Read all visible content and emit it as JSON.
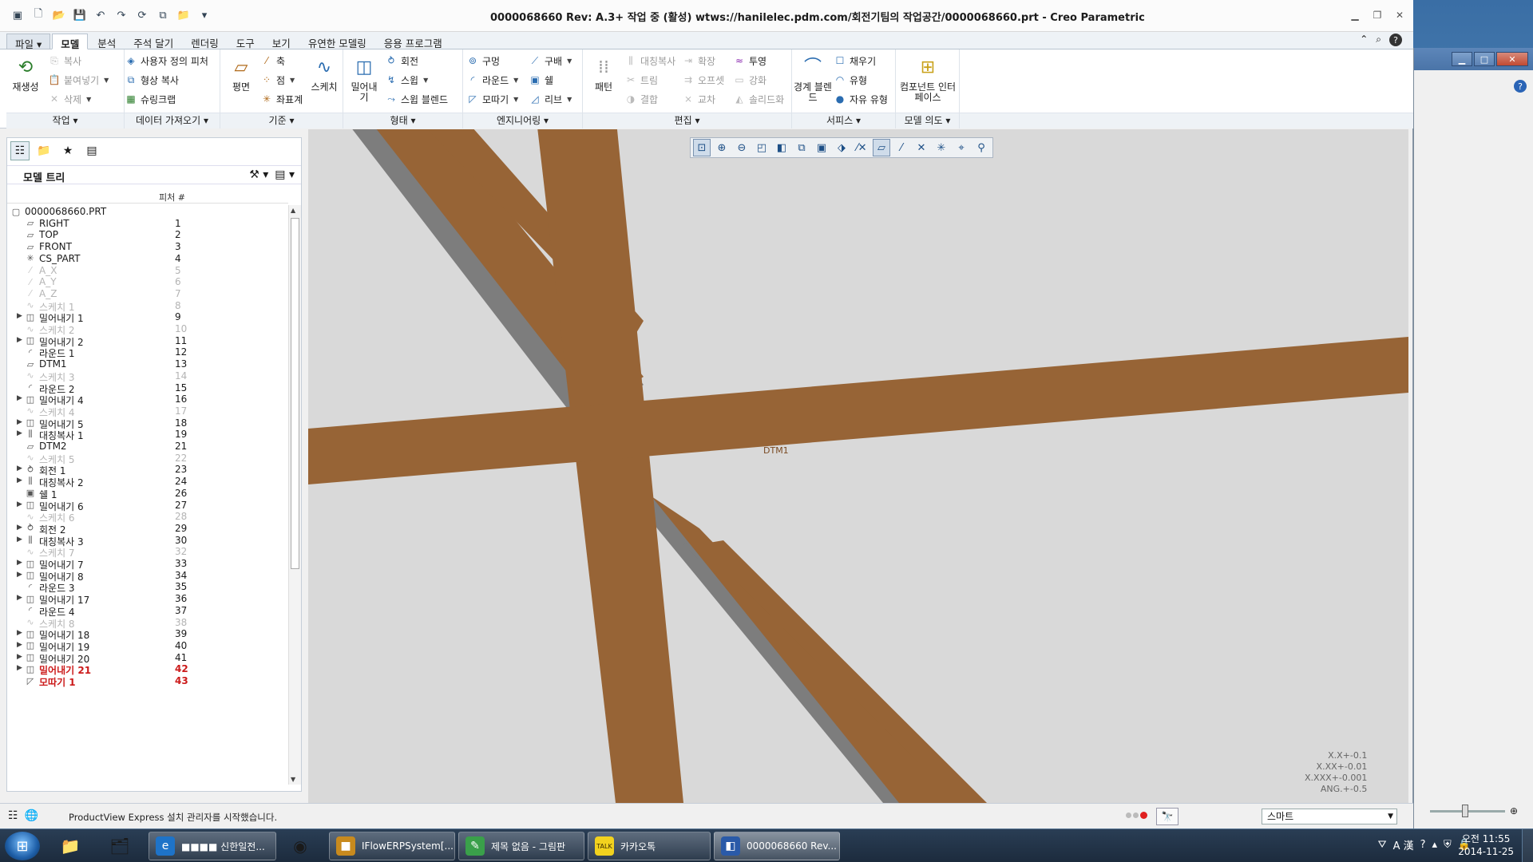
{
  "window": {
    "title": "0000068660 Rev: A.3+ 작업 중  (활성) wtws://hanilelec.pdm.com/회전기팀의 작업공간/0000068660.prt - Creo Parametric"
  },
  "tabs": [
    {
      "label": "파일 ▾",
      "kind": "file"
    },
    {
      "label": "모델",
      "kind": "active"
    },
    {
      "label": "분석",
      "kind": ""
    },
    {
      "label": "주석 달기",
      "kind": ""
    },
    {
      "label": "렌더링",
      "kind": ""
    },
    {
      "label": "도구",
      "kind": ""
    },
    {
      "label": "보기",
      "kind": ""
    },
    {
      "label": "유연한 모델링",
      "kind": ""
    },
    {
      "label": "응용 프로그램",
      "kind": ""
    }
  ],
  "ribbon": {
    "groups": {
      "operations": "작업",
      "get_data": "데이터 가져오기",
      "datum": "기준",
      "shapes": "형태",
      "engineering": "엔지니어링",
      "editing": "편집",
      "surfaces": "서피스",
      "model_intent": "모델 의도"
    },
    "regenerate": "재생성",
    "copy": "복사",
    "paste": "붙여넣기",
    "delete": "삭제",
    "user_defined_feature": "사용자 정의 피처",
    "copy_geometry": "형상 복사",
    "shrinkwrap": "슈링크랩",
    "plane": "평면",
    "axis": "축",
    "point": "점",
    "csys": "좌표계",
    "sketch": "스케치",
    "extrude": "밀어내기",
    "revolve": "회전",
    "sweep": "스윕",
    "swept_blend": "스윕 블렌드",
    "hole": "구멍",
    "round": "라운드",
    "chamfer": "모따기",
    "draft": "구배",
    "shell": "쉘",
    "rib": "리브",
    "pattern": "패턴",
    "mirror": "대칭복사",
    "trim": "트림",
    "merge": "결합",
    "extend": "확장",
    "offset": "오프셋",
    "intersect": "교차",
    "project": "투영",
    "thicken": "강화",
    "solidify": "솔리드화",
    "boundary_blend": "경계 블렌드",
    "fill": "채우기",
    "style": "유형",
    "freestyle": "자유 유형",
    "component_interface": "컴포넌트 인터페이스"
  },
  "model_tree": {
    "title": "모델 트리",
    "column_feature": "피처 #",
    "items": [
      {
        "name": "0000068660.PRT",
        "num": "",
        "icon": "part",
        "state": "",
        "expand": "",
        "root": true
      },
      {
        "name": "RIGHT",
        "num": "1",
        "icon": "plane",
        "state": "",
        "expand": ""
      },
      {
        "name": "TOP",
        "num": "2",
        "icon": "plane",
        "state": "",
        "expand": ""
      },
      {
        "name": "FRONT",
        "num": "3",
        "icon": "plane",
        "state": "",
        "expand": ""
      },
      {
        "name": "CS_PART",
        "num": "4",
        "icon": "csys",
        "state": "",
        "expand": ""
      },
      {
        "name": "A_X",
        "num": "5",
        "icon": "axis",
        "state": "dim",
        "expand": ""
      },
      {
        "name": "A_Y",
        "num": "6",
        "icon": "axis",
        "state": "dim",
        "expand": ""
      },
      {
        "name": "A_Z",
        "num": "7",
        "icon": "axis",
        "state": "dim",
        "expand": ""
      },
      {
        "name": "스케치 1",
        "num": "8",
        "icon": "sketch",
        "state": "dim",
        "expand": ""
      },
      {
        "name": "밀어내기 1",
        "num": "9",
        "icon": "extrude",
        "state": "",
        "expand": "▶"
      },
      {
        "name": "스케치 2",
        "num": "10",
        "icon": "sketch",
        "state": "dim",
        "expand": ""
      },
      {
        "name": "밀어내기 2",
        "num": "11",
        "icon": "extrude",
        "state": "",
        "expand": "▶"
      },
      {
        "name": "라운드 1",
        "num": "12",
        "icon": "round",
        "state": "",
        "expand": ""
      },
      {
        "name": "DTM1",
        "num": "13",
        "icon": "plane",
        "state": "",
        "expand": ""
      },
      {
        "name": "스케치 3",
        "num": "14",
        "icon": "sketch",
        "state": "dim",
        "expand": ""
      },
      {
        "name": "라운드 2",
        "num": "15",
        "icon": "round",
        "state": "",
        "expand": ""
      },
      {
        "name": "밀어내기 4",
        "num": "16",
        "icon": "extrude",
        "state": "",
        "expand": "▶"
      },
      {
        "name": "스케치 4",
        "num": "17",
        "icon": "sketch",
        "state": "dim",
        "expand": ""
      },
      {
        "name": "밀어내기 5",
        "num": "18",
        "icon": "extrude",
        "state": "",
        "expand": "▶"
      },
      {
        "name": "대칭복사 1",
        "num": "19",
        "icon": "mirror",
        "state": "",
        "expand": "▶"
      },
      {
        "name": "DTM2",
        "num": "21",
        "icon": "plane",
        "state": "",
        "expand": ""
      },
      {
        "name": "스케치 5",
        "num": "22",
        "icon": "sketch",
        "state": "dim",
        "expand": ""
      },
      {
        "name": "회전 1",
        "num": "23",
        "icon": "revolve",
        "state": "",
        "expand": "▶"
      },
      {
        "name": "대칭복사 2",
        "num": "24",
        "icon": "mirror",
        "state": "",
        "expand": "▶"
      },
      {
        "name": "쉘 1",
        "num": "26",
        "icon": "shell",
        "state": "",
        "expand": ""
      },
      {
        "name": "밀어내기 6",
        "num": "27",
        "icon": "extrude",
        "state": "",
        "expand": "▶"
      },
      {
        "name": "스케치 6",
        "num": "28",
        "icon": "sketch",
        "state": "dim",
        "expand": ""
      },
      {
        "name": "회전 2",
        "num": "29",
        "icon": "revolve",
        "state": "",
        "expand": "▶"
      },
      {
        "name": "대칭복사 3",
        "num": "30",
        "icon": "mirror",
        "state": "",
        "expand": "▶"
      },
      {
        "name": "스케치 7",
        "num": "32",
        "icon": "sketch",
        "state": "dim",
        "expand": ""
      },
      {
        "name": "밀어내기 7",
        "num": "33",
        "icon": "extrude",
        "state": "",
        "expand": "▶"
      },
      {
        "name": "밀어내기 8",
        "num": "34",
        "icon": "extrude",
        "state": "",
        "expand": "▶"
      },
      {
        "name": "라운드 3",
        "num": "35",
        "icon": "round",
        "state": "",
        "expand": ""
      },
      {
        "name": "밀어내기 17",
        "num": "36",
        "icon": "extrude",
        "state": "",
        "expand": "▶"
      },
      {
        "name": "라운드 4",
        "num": "37",
        "icon": "round",
        "state": "",
        "expand": ""
      },
      {
        "name": "스케치 8",
        "num": "38",
        "icon": "sketch",
        "state": "dim",
        "expand": ""
      },
      {
        "name": "밀어내기 18",
        "num": "39",
        "icon": "extrude",
        "state": "",
        "expand": "▶"
      },
      {
        "name": "밀어내기 19",
        "num": "40",
        "icon": "extrude",
        "state": "",
        "expand": "▶"
      },
      {
        "name": "밀어내기 20",
        "num": "41",
        "icon": "extrude",
        "state": "",
        "expand": "▶"
      },
      {
        "name": "밀어내기 21",
        "num": "42",
        "icon": "extrude",
        "state": "red",
        "expand": "▶"
      },
      {
        "name": "모따기 1",
        "num": "43",
        "icon": "chamfer",
        "state": "red",
        "expand": ""
      }
    ]
  },
  "viewport": {
    "datum_label": "DTM1",
    "tolerance": [
      "X.X+-0.1",
      "X.XX+-0.01",
      "X.XXX+-0.001",
      "ANG.+-0.5"
    ],
    "model_color": "#976436",
    "shadow_color": "#7d7d7d",
    "background_color": "#d9d9d9"
  },
  "status": {
    "message": "ProductView Express 설치 관리자를 시작했습니다.",
    "selection_filter": "스마트"
  },
  "taskbar": {
    "tasks": [
      {
        "label": "■■■■ 신한일전...",
        "icon": "e"
      },
      {
        "label": "IFlowERPSystem[...",
        "icon": "■"
      },
      {
        "label": "제목 없음 - 그림판",
        "icon": "✎"
      },
      {
        "label": "카카오톡",
        "icon": "TALK"
      },
      {
        "label": "0000068660 Rev...",
        "icon": "◧"
      }
    ],
    "time": "오전 11:55",
    "date": "2014-11-25"
  }
}
